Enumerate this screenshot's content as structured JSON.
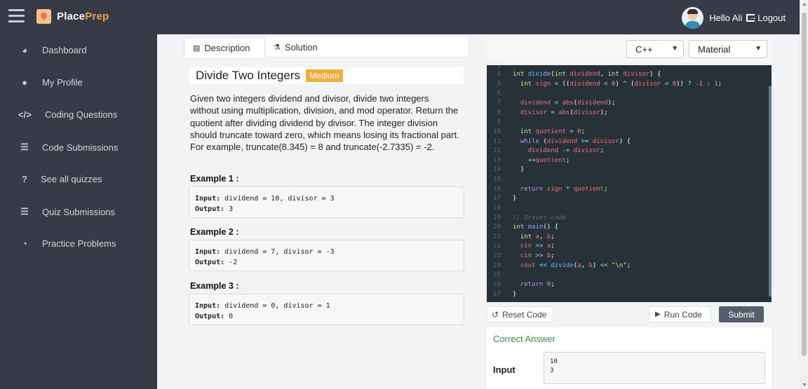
{
  "app": {
    "logo_main": "Place",
    "logo_accent": "Prep",
    "greeting": "Hello Ali",
    "logout_label": "Logout"
  },
  "sidebar": {
    "items": [
      {
        "label": "Dashboard",
        "icon": "gauge-icon"
      },
      {
        "label": "My Profile",
        "icon": "user-circle-icon"
      },
      {
        "label": "Coding Questions",
        "icon": "code-icon"
      },
      {
        "label": "Code Submissions",
        "icon": "list-check-icon"
      },
      {
        "label": "See all quizzes",
        "icon": "question-icon"
      },
      {
        "label": "Quiz Submissions",
        "icon": "list-check-icon"
      },
      {
        "label": "Practice Problems",
        "icon": "pie-chart-icon"
      }
    ]
  },
  "tabs": {
    "description": "Description",
    "solution": "Solution"
  },
  "problem": {
    "title": "Divide Two Integers",
    "difficulty": "Medium",
    "description": "Given two integers dividend and divisor, divide two integers without using multiplication, division, and mod operator. Return the quotient after dividing dividend by divisor. The integer division should truncate toward zero, which means losing its fractional part. For example, truncate(8.345) = 8 and truncate(-2.7335) = -2.",
    "examples": [
      {
        "heading": "Example 1 :",
        "input_label": "Input:",
        "input": " dividend = 10, divisor = 3",
        "output_label": "Output:",
        "output": " 3"
      },
      {
        "heading": "Example 2 :",
        "input_label": "Input:",
        "input": " dividend = 7, divisor = -3",
        "output_label": "Output:",
        "output": " -2"
      },
      {
        "heading": "Example 3 :",
        "input_label": "Input:",
        "input": " dividend = 0, divisor = 1",
        "output_label": "Output:",
        "output": " 0"
      }
    ]
  },
  "editor": {
    "language": "C++",
    "theme": "Material",
    "reset_label": "Reset Code",
    "run_label": "Run Code",
    "submit_label": "Submit"
  },
  "result": {
    "status": "Correct Answer",
    "input_label": "Input",
    "input_value": "10\n3"
  },
  "colors": {
    "sidebar_bg": "#373a47",
    "editor_bg": "#263238",
    "badge": "#f0ad3e",
    "success": "#3c8c4c",
    "submit_bg": "#555e6b"
  }
}
